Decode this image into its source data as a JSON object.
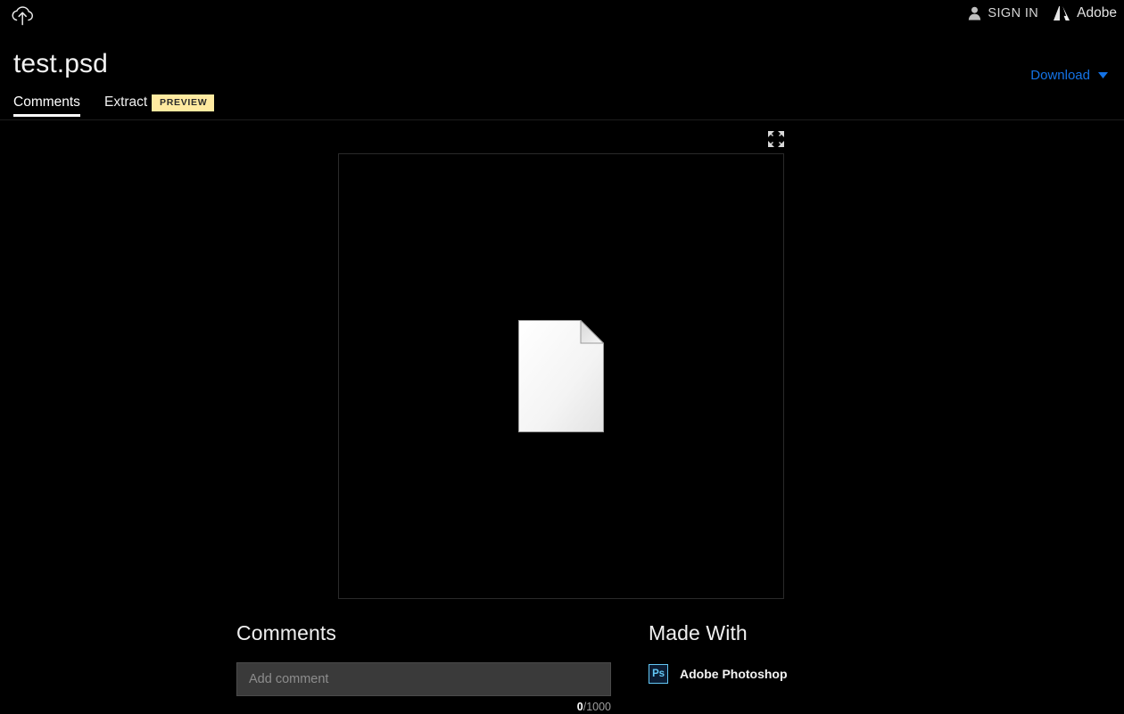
{
  "topbar": {
    "upload_icon": "cloud-upload-icon",
    "signin_label": "SIGN IN",
    "signin_icon": "person-icon",
    "brand_label": "Adobe",
    "brand_icon": "adobe-logo-icon"
  },
  "header": {
    "file_title": "test.psd",
    "download_label": "Download",
    "download_caret_icon": "chevron-down-icon"
  },
  "tabs": [
    {
      "label": "Comments",
      "active": true
    },
    {
      "label": "Extract",
      "active": false
    }
  ],
  "preview_badge": "PREVIEW",
  "preview": {
    "expand_icon": "expand-fullscreen-icon",
    "thumbnail_icon": "generic-document-icon"
  },
  "comments": {
    "heading": "Comments",
    "input_value": "",
    "input_placeholder": "Add comment",
    "counter_current": "0",
    "counter_max": "/1000"
  },
  "made_with": {
    "heading": "Made With",
    "app_icon_label": "Ps",
    "app_name": "Adobe Photoshop"
  },
  "colors": {
    "background": "#000000",
    "accent_link": "#1473e6",
    "badge_bg": "#ffeaa0",
    "ps_blue": "#63c7f5",
    "input_bg": "#3a3a3a"
  }
}
